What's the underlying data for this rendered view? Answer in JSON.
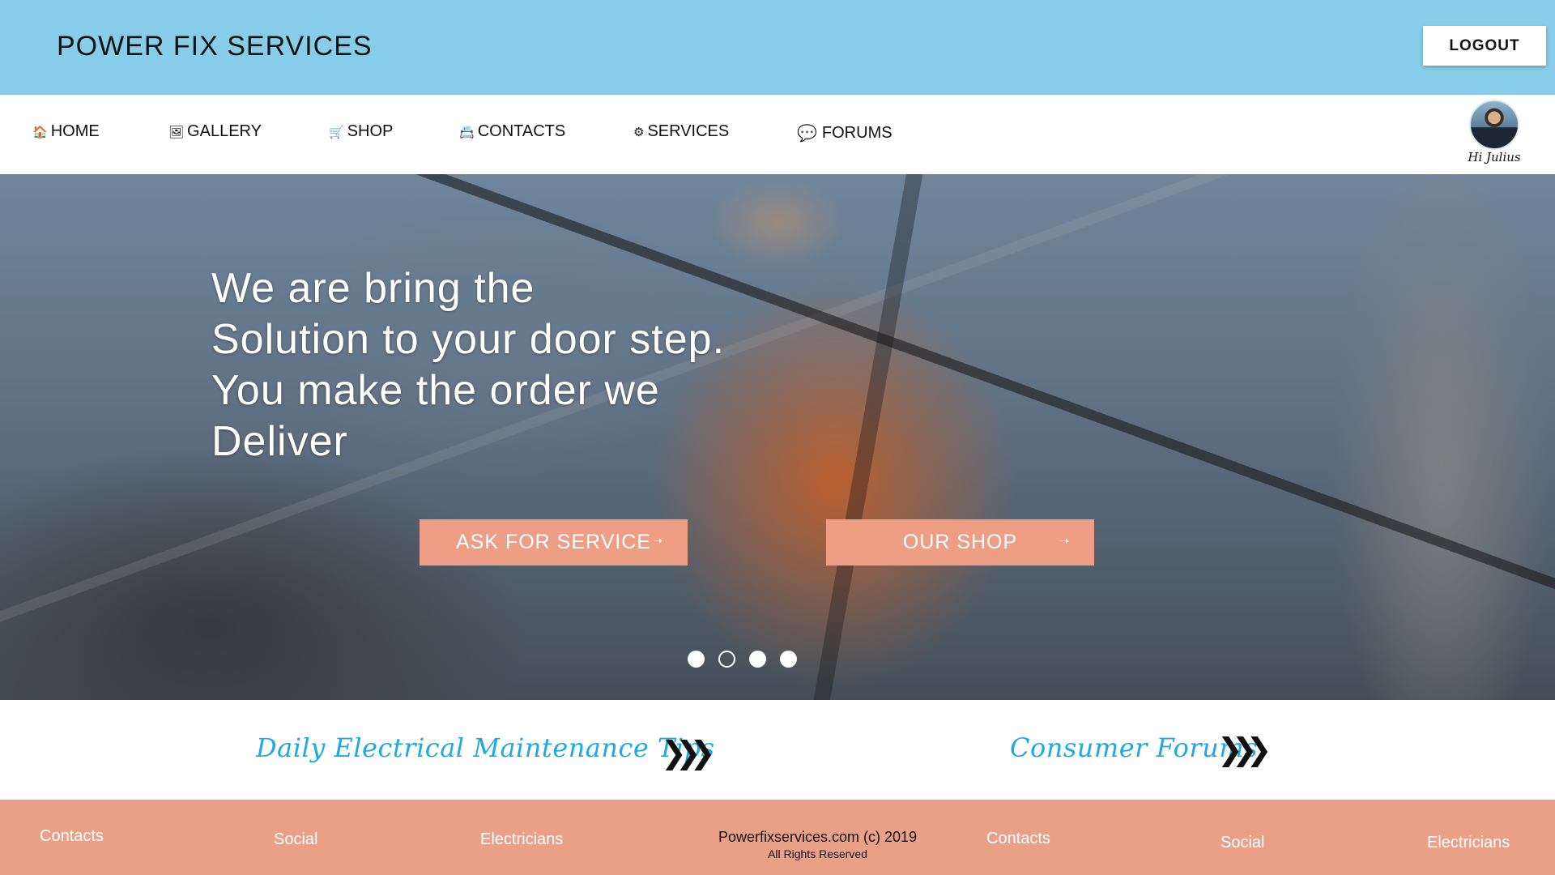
{
  "header": {
    "brand": "POWER FIX SERVICES",
    "logout_label": "LOGOUT"
  },
  "nav": {
    "items": [
      {
        "icon": "home-icon",
        "glyph": "🏠",
        "label": "HOME"
      },
      {
        "icon": "gallery-icon",
        "glyph": "🖼",
        "label": "GALLERY"
      },
      {
        "icon": "cart-icon",
        "glyph": "🛒",
        "label": "SHOP"
      },
      {
        "icon": "contacts-icon",
        "glyph": "📇",
        "label": "CONTACTS"
      },
      {
        "icon": "gear-icon",
        "glyph": "⚙",
        "label": "SERVICES"
      },
      {
        "icon": "chat-icon",
        "glyph": "💬",
        "label": "FORUMS"
      }
    ],
    "user_greeting": "Hi Julius"
  },
  "hero": {
    "headline_lines": [
      "We are bring the",
      "Solution to your door step.",
      "You make the order we",
      "Deliver"
    ],
    "ask_service_label": "ASK FOR SERVICE",
    "our_shop_label": "OUR SHOP",
    "arrow_glyph": "➝",
    "carousel": {
      "slides": 4,
      "active": 2
    }
  },
  "promos": {
    "tips_label": "Daily Electrical Maintenance Tips",
    "forums_label": "Consumer Forums",
    "chevron_glyph": "❯❯❯"
  },
  "footer": {
    "left_links": [
      "Contacts",
      "Social",
      "Electricians"
    ],
    "right_links": [
      "Contacts",
      "Social",
      "Electricians"
    ],
    "copyright": "Powerfixservices.com (c) 2019",
    "rights": "All Rights Reserved"
  },
  "colors": {
    "header_bg": "#87CDEA",
    "button_bg": "#EE9E84",
    "footer_bg": "#EAA086",
    "link_blue": "#1da9e1"
  }
}
